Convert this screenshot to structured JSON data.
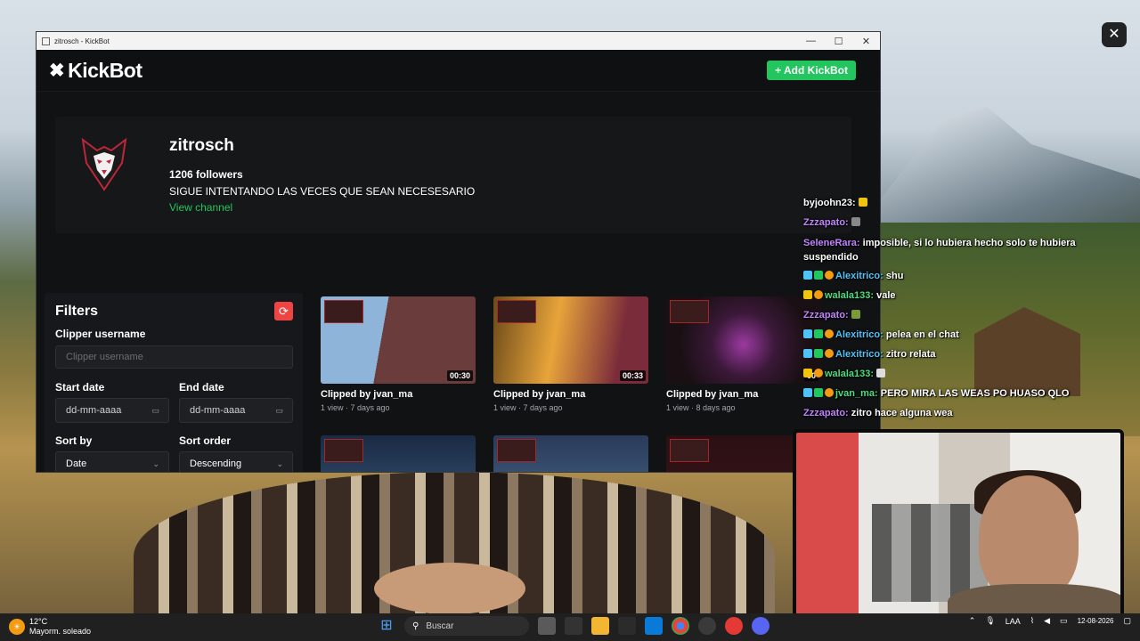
{
  "desktop": {
    "close_glyph": "✕"
  },
  "window": {
    "title": "zitrosch - KickBot",
    "controls": {
      "minimize": "—",
      "maximize": "☐",
      "close": "✕"
    }
  },
  "app": {
    "logo_icon": "✖",
    "logo_text": "KickBot",
    "add_button": "+ Add KickBot",
    "accent_color": "#22c55e"
  },
  "profile": {
    "name": "zitrosch",
    "followers": "1206 followers",
    "bio": "SIGUE INTENTANDO LAS VECES QUE SEAN NECESESARIO",
    "link": "View channel",
    "avatar_icon": "wolf-logo-icon"
  },
  "filters": {
    "title": "Filters",
    "reset_icon": "⟳",
    "clipper_label": "Clipper username",
    "clipper_placeholder": "Clipper username",
    "start_label": "Start date",
    "start_value": "dd-mm-aaaa",
    "end_label": "End date",
    "end_value": "dd-mm-aaaa",
    "sort_by_label": "Sort by",
    "sort_by_value": "Date",
    "sort_order_label": "Sort order",
    "sort_order_value": "Descending",
    "calendar_icon": "▭",
    "chevron_icon": "⌄"
  },
  "clips": [
    {
      "title": "Clipped by jvan_ma",
      "meta": "1 view · 7 days ago",
      "duration": "00:30"
    },
    {
      "title": "Clipped by jvan_ma",
      "meta": "1 view · 7 days ago",
      "duration": "00:33"
    },
    {
      "title": "Clipped by jvan_ma",
      "meta": "1 view · 8 days ago",
      "duration": "00"
    },
    {
      "title": "",
      "meta": "",
      "duration": ""
    },
    {
      "title": "",
      "meta": "",
      "duration": ""
    },
    {
      "title": "",
      "meta": "",
      "duration": ""
    }
  ],
  "chat": [
    {
      "user": "byjoohn23:",
      "color": "#ffffff",
      "msg": ""
    },
    {
      "user": "Zzzapato:",
      "color": "#b57cf5",
      "msg": ""
    },
    {
      "user": "SeleneRara:",
      "color": "#b57cf5",
      "msg": "imposible, si lo hubiera hecho solo te hubiera suspendido"
    },
    {
      "user": "Alexitrico:",
      "color": "#4fc3f7",
      "msg": "shu"
    },
    {
      "user": "walala133:",
      "color": "#22c55e",
      "msg": "vale"
    },
    {
      "user": "Zzzapato:",
      "color": "#b57cf5",
      "msg": ""
    },
    {
      "user": "Alexitrico:",
      "color": "#4fc3f7",
      "msg": "pelea en el chat"
    },
    {
      "user": "Alexitrico:",
      "color": "#4fc3f7",
      "msg": "zitro relata"
    },
    {
      "user": "walala133:",
      "color": "#22c55e",
      "msg": ""
    },
    {
      "user": "jvan_ma:",
      "color": "#22c55e",
      "msg": "PERO MIRA LAS WEAS PO HUASO QLO"
    },
    {
      "user": "Zzzapato:",
      "color": "#b57cf5",
      "msg": "zitro hace alguna wea"
    }
  ],
  "taskbar": {
    "temperature": "12°C",
    "weather": "Mayorm. soleado",
    "search_placeholder": "Buscar",
    "lang": "LAA",
    "date": "12-08-2026"
  }
}
